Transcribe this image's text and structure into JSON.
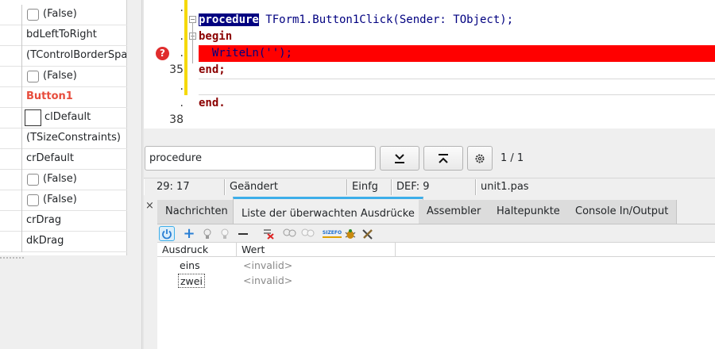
{
  "inspector": {
    "rows": [
      {
        "value": "(False)",
        "check": true
      },
      {
        "value": "bdLeftToRight"
      },
      {
        "value": "(TControlBorderSpacing)"
      },
      {
        "value": "(False)",
        "check": true
      },
      {
        "value": "Button1",
        "highlight": true
      },
      {
        "value": "clDefault",
        "color_swatch": "#ffffff"
      },
      {
        "value": "(TSizeConstraints)"
      },
      {
        "value": "crDefault"
      },
      {
        "value": "(False)",
        "check": true
      },
      {
        "value": "(False)",
        "check": true
      },
      {
        "value": "crDrag"
      },
      {
        "value": "dkDrag"
      }
    ]
  },
  "editor": {
    "gutter": {
      "line_a": "35",
      "line_b": "38",
      "dot": "."
    },
    "lines": {
      "l1_kw": "procedure",
      "l1_rest": " TForm1.Button1Click(Sender: TObject);",
      "l2": "begin",
      "l3": "  WriteLn('');",
      "l4": "end;",
      "l6": "end."
    },
    "error_icon": "?",
    "colors": {
      "error_line": "#ff0000",
      "keyword": "#8b0000",
      "identifier": "#000080",
      "change_bar": "#f5d90a"
    }
  },
  "search": {
    "value": "procedure",
    "find_next_icon": "find-next-icon",
    "find_prev_icon": "find-previous-icon",
    "options_icon": "gear-icon",
    "count": "1 / 1"
  },
  "statusbar": {
    "position": "29: 17",
    "modified": "Geändert",
    "mode": "Einfg",
    "encoding": "DEF: 9",
    "file": "unit1.pas"
  },
  "debug": {
    "close_label": "×",
    "tabs": [
      "Nachrichten",
      "Liste der überwachten Ausdrücke",
      "Assembler",
      "Haltepunkte",
      "Console In/Output"
    ],
    "active_tab": 1,
    "accent": "#3daee9",
    "columns": [
      "Ausdruck",
      "Wert"
    ],
    "rows": [
      {
        "expr": "eins",
        "value": "<invalid>"
      },
      {
        "expr": "zwei",
        "value": "<invalid>"
      }
    ],
    "toolbar_badge": "SIZEFO"
  }
}
